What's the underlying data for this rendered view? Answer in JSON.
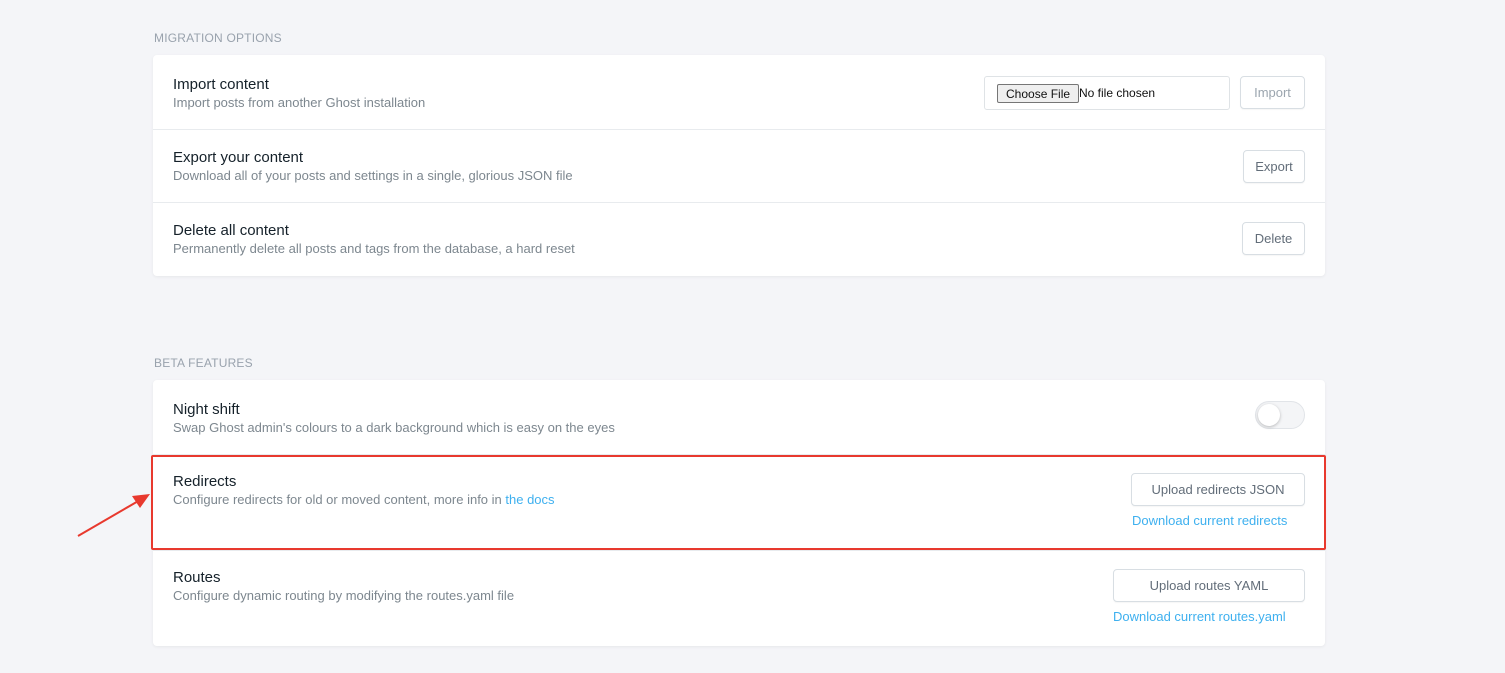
{
  "migration": {
    "section_title": "MIGRATION OPTIONS",
    "import": {
      "title": "Import content",
      "description": "Import posts from another Ghost installation",
      "choose_file_label": "Choose File",
      "no_file_text": "No file chosen",
      "button_label": "Import"
    },
    "export": {
      "title": "Export your content",
      "description": "Download all of your posts and settings in a single, glorious JSON file",
      "button_label": "Export"
    },
    "delete": {
      "title": "Delete all content",
      "description": "Permanently delete all posts and tags from the database, a hard reset",
      "button_label": "Delete"
    }
  },
  "beta": {
    "section_title": "BETA FEATURES",
    "night_shift": {
      "title": "Night shift",
      "description": "Swap Ghost admin's colours to a dark background which is easy on the eyes",
      "enabled": false
    },
    "redirects": {
      "title": "Redirects",
      "description": "Configure redirects for old or moved content, more info in ",
      "docs_link": "the docs",
      "upload_label": "Upload redirects JSON",
      "download_label": "Download current redirects"
    },
    "routes": {
      "title": "Routes",
      "description": "Configure dynamic routing by modifying the routes.yaml file",
      "upload_label": "Upload routes YAML",
      "download_label": "Download current routes.yaml"
    }
  },
  "colors": {
    "accent_link": "#3eb0ef",
    "highlight_annotation": "#e8392e",
    "background": "#f4f5f8"
  }
}
